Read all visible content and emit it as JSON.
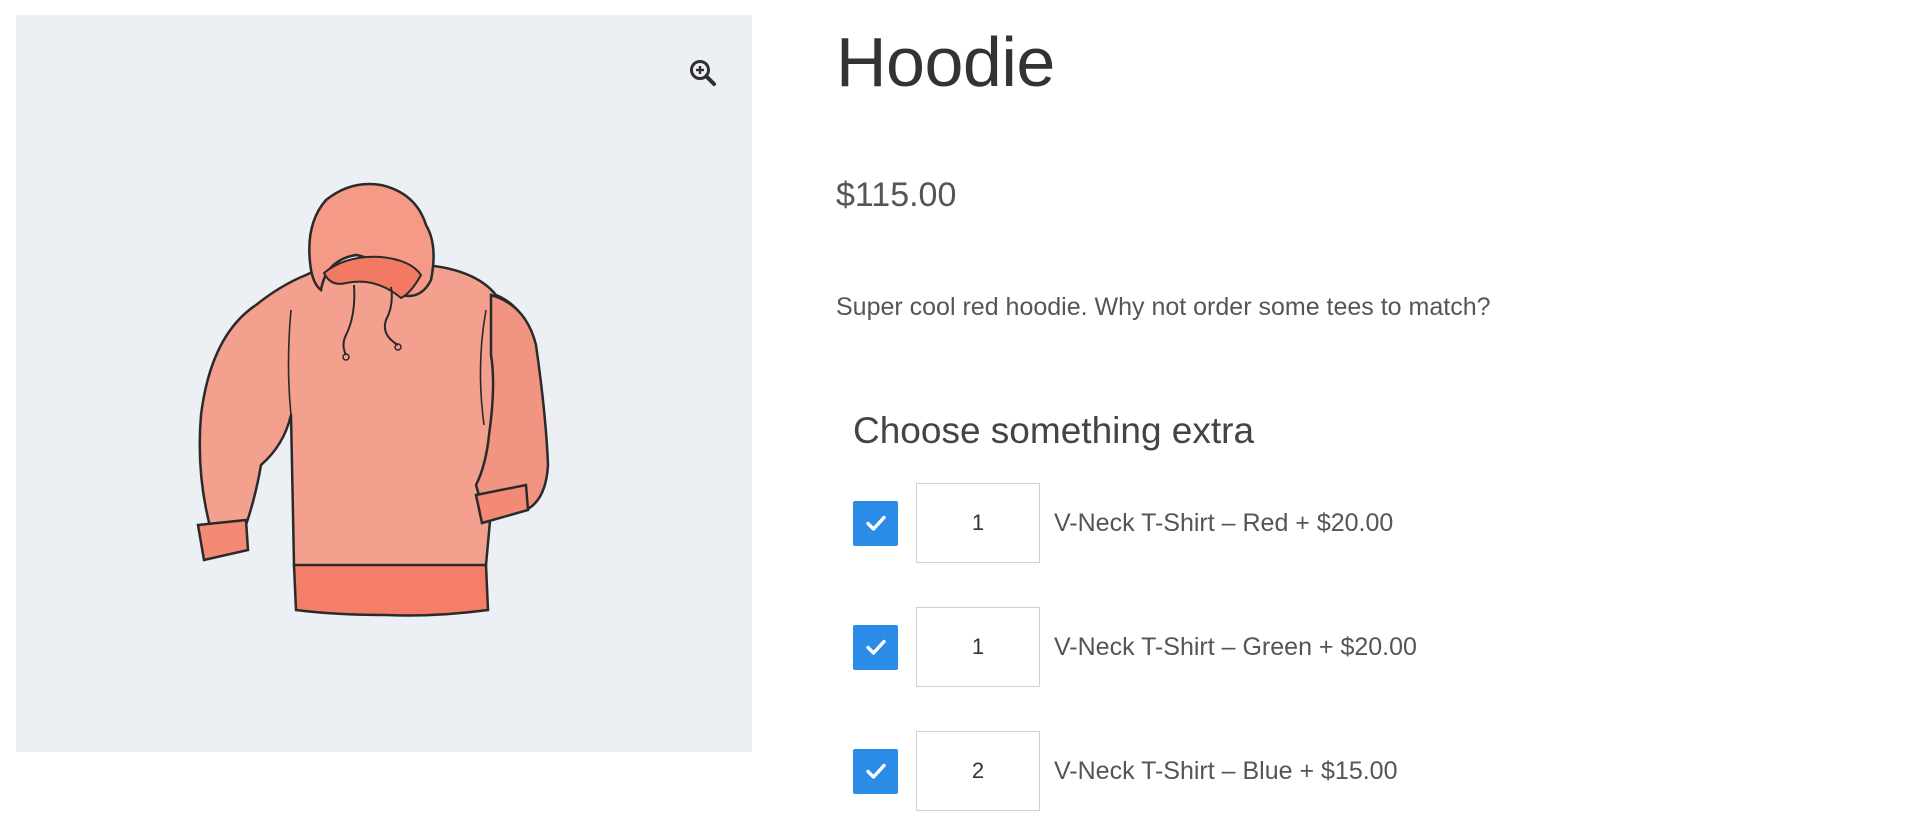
{
  "product": {
    "title": "Hoodie",
    "price": "$115.00",
    "description": "Super cool red hoodie. Why not order some tees to match?",
    "image": "red-hoodie-illustration"
  },
  "gallery": {
    "zoom_icon": "zoom-in-icon",
    "background_color": "#eceff4"
  },
  "extras": {
    "heading": "Choose something extra",
    "items": [
      {
        "checked": true,
        "qty": "1",
        "label": "V-Neck T-Shirt – Red + $20.00"
      },
      {
        "checked": true,
        "qty": "1",
        "label": "V-Neck T-Shirt – Green + $20.00"
      },
      {
        "checked": true,
        "qty": "2",
        "label": "V-Neck T-Shirt – Blue + $15.00"
      }
    ]
  },
  "colors": {
    "checkbox": "#2b8ce8",
    "hoodie": "#f4a08f"
  }
}
